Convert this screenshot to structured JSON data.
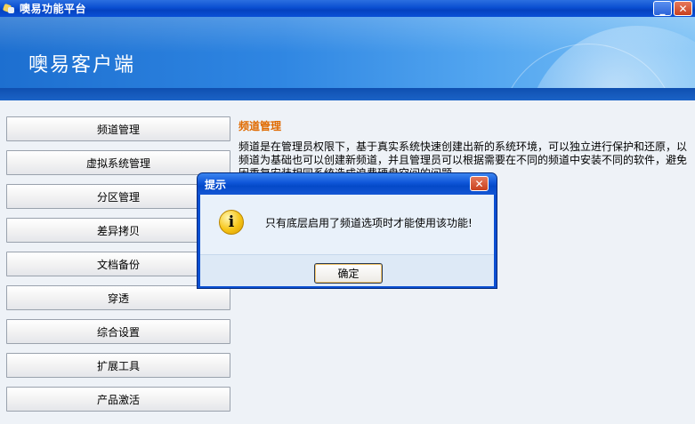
{
  "window": {
    "title": "噢易功能平台",
    "minimize_label": "_",
    "close_label": "✕"
  },
  "banner": {
    "brand": "噢易客户端"
  },
  "sidebar": {
    "items": [
      {
        "label": "频道管理"
      },
      {
        "label": "虚拟系统管理"
      },
      {
        "label": "分区管理"
      },
      {
        "label": "差异拷贝"
      },
      {
        "label": "文档备份"
      },
      {
        "label": "穿透"
      },
      {
        "label": "综合设置"
      },
      {
        "label": "扩展工具"
      },
      {
        "label": "产品激活"
      }
    ]
  },
  "content": {
    "heading": "频道管理",
    "description": "频道是在管理员权限下，基于真实系统快速创建出新的系统环境，可以独立进行保护和还原，以频道为基础也可以创建新频道，并且管理员可以根据需要在不同的频道中安装不同的软件，避免因重复安装相同系统造成浪费硬盘空间的问题。"
  },
  "dialog": {
    "title": "提示",
    "close_label": "✕",
    "icon": "warning-icon",
    "icon_glyph": "i",
    "message": "只有底层启用了频道选项时才能使用该功能!",
    "ok_label": "确定"
  },
  "colors": {
    "titlebar": "#0a4fd1",
    "banner": "#2f86e2",
    "heading": "#e06a00",
    "dialog_body": "#e9f1fa"
  }
}
